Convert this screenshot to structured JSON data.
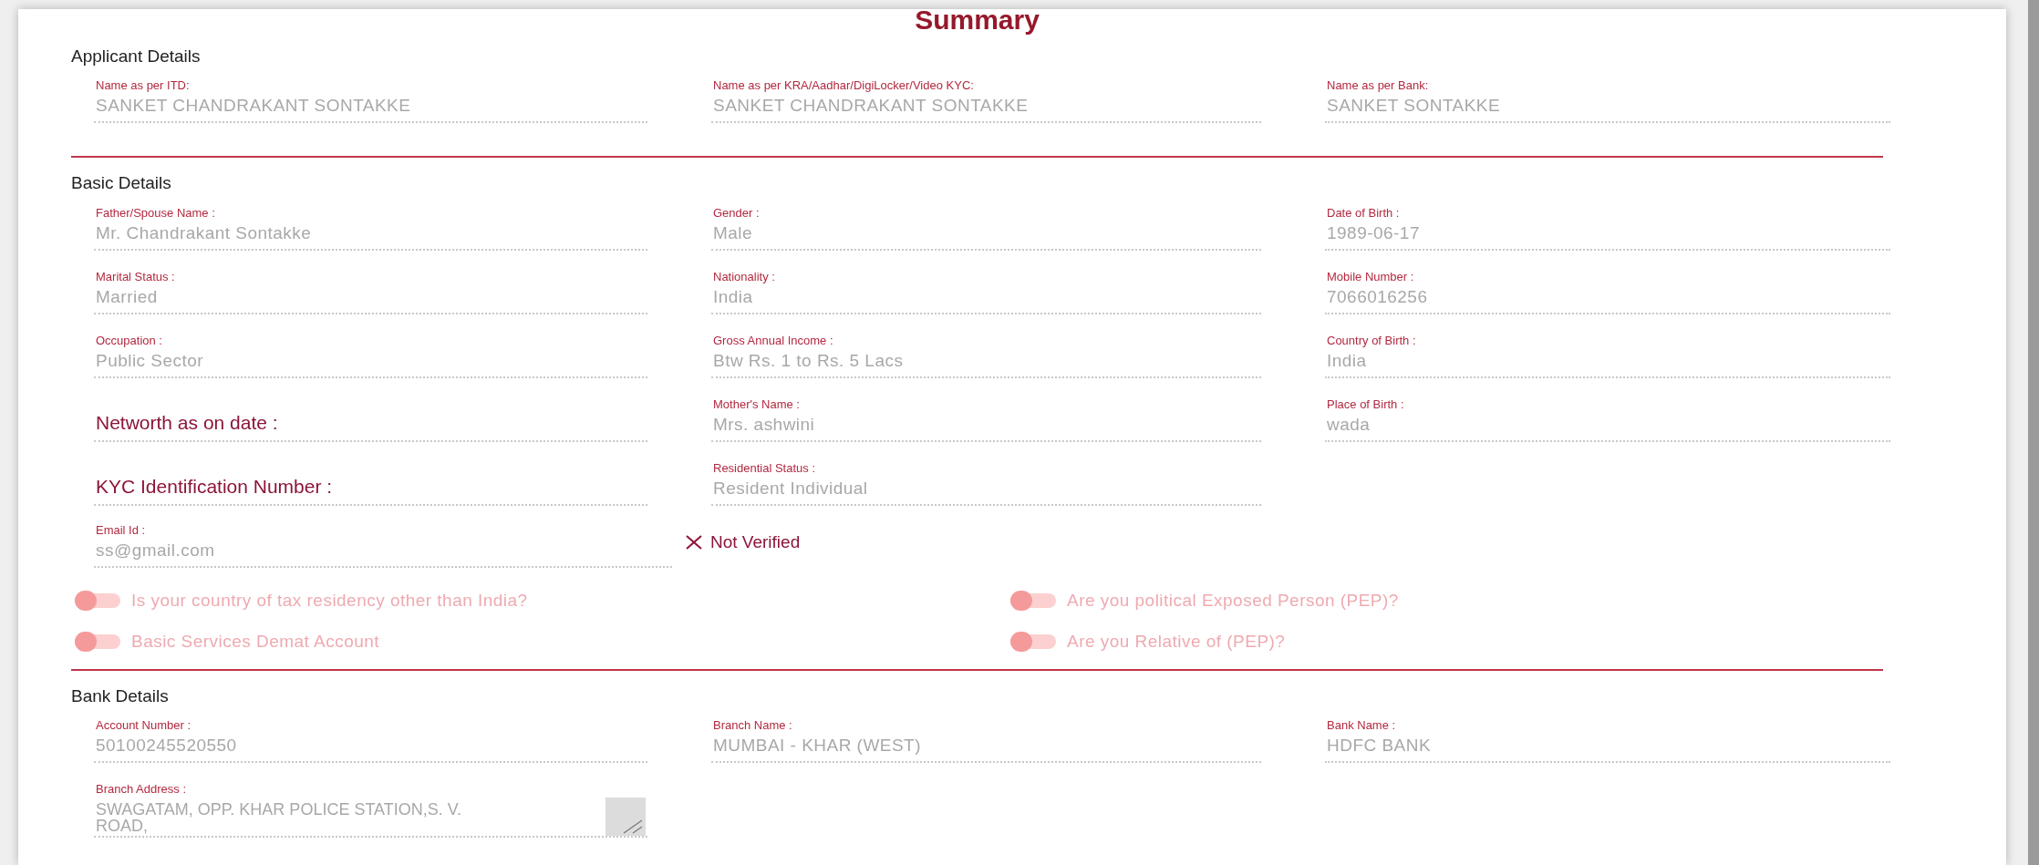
{
  "title": "Summary",
  "applicant": {
    "heading": "Applicant Details",
    "fields": [
      {
        "kind": "field",
        "label": "Name as per ITD:",
        "value": "SANKET CHANDRAKANT SONTAKKE"
      },
      {
        "kind": "field",
        "label": "Name as per KRA/Aadhar/DigiLocker/Video KYC:",
        "value": "SANKET CHANDRAKANT SONTAKKE"
      },
      {
        "kind": "field",
        "label": "Name as per Bank:",
        "value": "SANKET SONTAKKE"
      }
    ]
  },
  "basic": {
    "heading": "Basic Details",
    "fields": [
      {
        "kind": "field",
        "label": "Father/Spouse Name :",
        "value": "Mr. Chandrakant  Sontakke"
      },
      {
        "kind": "field",
        "label": "Gender :",
        "value": "Male"
      },
      {
        "kind": "field",
        "label": "Date of Birth :",
        "value": "1989-06-17"
      },
      {
        "kind": "field",
        "label": "Marital Status :",
        "value": "Married"
      },
      {
        "kind": "field",
        "label": "Nationality :",
        "value": "India"
      },
      {
        "kind": "field",
        "label": "Mobile Number :",
        "value": "7066016256"
      },
      {
        "kind": "field",
        "label": "Occupation :",
        "value": "Public Sector"
      },
      {
        "kind": "field",
        "label": "Gross Annual Income :",
        "value": "Btw Rs. 1 to Rs. 5 Lacs"
      },
      {
        "kind": "field",
        "label": "Country of Birth :",
        "value": "India"
      },
      {
        "kind": "heading",
        "label": "Networth as on date :"
      },
      {
        "kind": "field",
        "label": "Mother's Name :",
        "value": "Mrs. ashwini"
      },
      {
        "kind": "field",
        "label": "Place of Birth :",
        "value": "wada"
      },
      {
        "kind": "heading",
        "label": "KYC Identification Number :"
      },
      {
        "kind": "field",
        "label": "Residential Status :",
        "value": "Resident Individual"
      }
    ],
    "email": {
      "label": "Email Id :",
      "value": "ss@gmail.com",
      "verified": false,
      "status": "Not Verified"
    },
    "toggles": [
      {
        "label": "Is your country of tax residency other than India?",
        "on": false
      },
      {
        "label": "Are you political Exposed Person (PEP)?",
        "on": false
      },
      {
        "label": "Basic Services Demat Account",
        "on": false
      },
      {
        "label": "Are you Relative of (PEP)?",
        "on": false
      }
    ]
  },
  "bank": {
    "heading": "Bank Details",
    "fields": [
      {
        "kind": "field",
        "label": "Account Number :",
        "value": "50100245520550"
      },
      {
        "kind": "field",
        "label": "Branch Name :",
        "value": "MUMBAI - KHAR (WEST)"
      },
      {
        "kind": "field",
        "label": "Bank Name :",
        "value": "HDFC BANK"
      },
      {
        "kind": "textarea",
        "label": "Branch Address :",
        "value": "SWAGATAM, OPP. KHAR POLICE STATION,S. V. ROAD,"
      }
    ]
  }
}
